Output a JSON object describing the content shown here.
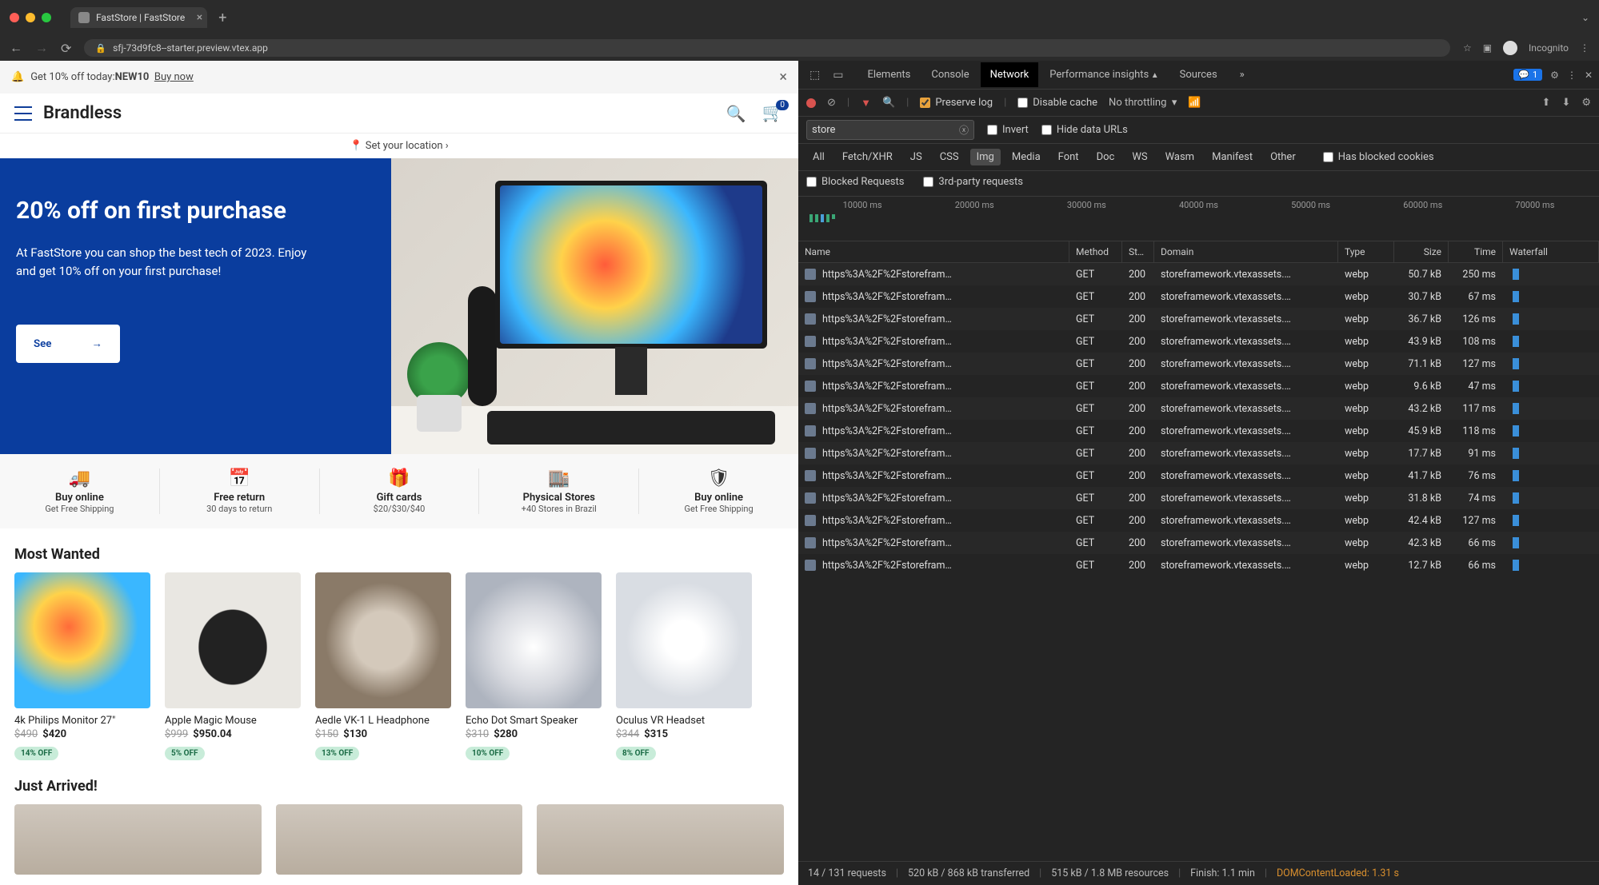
{
  "browser": {
    "tab_title": "FastStore | FastStore",
    "url": "sfj-73d9fc8--starter.preview.vtex.app",
    "incognito_label": "Incognito"
  },
  "site": {
    "promo": {
      "text_prefix": "Get 10% off today: ",
      "code": "NEW10",
      "link": "Buy now"
    },
    "brand": "Brandless",
    "cart_count": "0",
    "location_cta": "Set your location",
    "hero": {
      "title": "20% off on first purchase",
      "body": "At FastStore you can shop the best tech of 2023. Enjoy and get 10% off on your first purchase!",
      "btn": "See"
    },
    "features": [
      {
        "icon": "🚚",
        "title": "Buy online",
        "sub": "Get Free Shipping"
      },
      {
        "icon": "📅",
        "title": "Free return",
        "sub": "30 days to return"
      },
      {
        "icon": "🎁",
        "title": "Gift cards",
        "sub": "$20/$30/$40"
      },
      {
        "icon": "🏬",
        "title": "Physical Stores",
        "sub": "+40 Stores in Brazil"
      },
      {
        "icon": "🛡",
        "title": "Buy online",
        "sub": "Get Free Shipping"
      }
    ],
    "section_most": "Most Wanted",
    "products": [
      {
        "name": "4k Philips Monitor 27\"",
        "old": "$490",
        "new": "$420",
        "disc": "14% OFF"
      },
      {
        "name": "Apple Magic Mouse",
        "old": "$999",
        "new": "$950.04",
        "disc": "5% OFF"
      },
      {
        "name": "Aedle VK-1 L Headphone",
        "old": "$150",
        "new": "$130",
        "disc": "13% OFF"
      },
      {
        "name": "Echo Dot Smart Speaker",
        "old": "$310",
        "new": "$280",
        "disc": "10% OFF"
      },
      {
        "name": "Oculus VR Headset",
        "old": "$344",
        "new": "$315",
        "disc": "8% OFF"
      }
    ],
    "section_arrived": "Just Arrived!"
  },
  "devtools": {
    "tabs": [
      "Elements",
      "Console",
      "Network",
      "Performance insights",
      "Sources"
    ],
    "more": "»",
    "messages_count": "1",
    "toolbar": {
      "preserve": "Preserve log",
      "disable_cache": "Disable cache",
      "throttling": "No throttling"
    },
    "filter": {
      "value": "store",
      "invert": "Invert",
      "hide_urls": "Hide data URLs"
    },
    "types": [
      "All",
      "Fetch/XHR",
      "JS",
      "CSS",
      "Img",
      "Media",
      "Font",
      "Doc",
      "WS",
      "Wasm",
      "Manifest",
      "Other"
    ],
    "types_active": "Img",
    "blocked_cookies": "Has blocked cookies",
    "blocked_requests": "Blocked Requests",
    "third_party": "3rd-party requests",
    "timeline_labels": [
      "10000 ms",
      "20000 ms",
      "30000 ms",
      "40000 ms",
      "50000 ms",
      "60000 ms",
      "70000 ms"
    ],
    "columns": [
      "Name",
      "Method",
      "St…",
      "Domain",
      "Type",
      "Size",
      "Time",
      "Waterfall"
    ],
    "rows": [
      {
        "name": "https%3A%2F%2Fstorefram…",
        "method": "GET",
        "status": "200",
        "domain": "storeframework.vtexassets.…",
        "type": "webp",
        "size": "50.7 kB",
        "time": "250 ms"
      },
      {
        "name": "https%3A%2F%2Fstorefram…",
        "method": "GET",
        "status": "200",
        "domain": "storeframework.vtexassets.…",
        "type": "webp",
        "size": "30.7 kB",
        "time": "67 ms"
      },
      {
        "name": "https%3A%2F%2Fstorefram…",
        "method": "GET",
        "status": "200",
        "domain": "storeframework.vtexassets.…",
        "type": "webp",
        "size": "36.7 kB",
        "time": "126 ms"
      },
      {
        "name": "https%3A%2F%2Fstorefram…",
        "method": "GET",
        "status": "200",
        "domain": "storeframework.vtexassets.…",
        "type": "webp",
        "size": "43.9 kB",
        "time": "108 ms"
      },
      {
        "name": "https%3A%2F%2Fstorefram…",
        "method": "GET",
        "status": "200",
        "domain": "storeframework.vtexassets.…",
        "type": "webp",
        "size": "71.1 kB",
        "time": "127 ms"
      },
      {
        "name": "https%3A%2F%2Fstorefram…",
        "method": "GET",
        "status": "200",
        "domain": "storeframework.vtexassets.…",
        "type": "webp",
        "size": "9.6 kB",
        "time": "47 ms"
      },
      {
        "name": "https%3A%2F%2Fstorefram…",
        "method": "GET",
        "status": "200",
        "domain": "storeframework.vtexassets.…",
        "type": "webp",
        "size": "43.2 kB",
        "time": "117 ms"
      },
      {
        "name": "https%3A%2F%2Fstorefram…",
        "method": "GET",
        "status": "200",
        "domain": "storeframework.vtexassets.…",
        "type": "webp",
        "size": "45.9 kB",
        "time": "118 ms"
      },
      {
        "name": "https%3A%2F%2Fstorefram…",
        "method": "GET",
        "status": "200",
        "domain": "storeframework.vtexassets.…",
        "type": "webp",
        "size": "17.7 kB",
        "time": "91 ms"
      },
      {
        "name": "https%3A%2F%2Fstorefram…",
        "method": "GET",
        "status": "200",
        "domain": "storeframework.vtexassets.…",
        "type": "webp",
        "size": "41.7 kB",
        "time": "76 ms"
      },
      {
        "name": "https%3A%2F%2Fstorefram…",
        "method": "GET",
        "status": "200",
        "domain": "storeframework.vtexassets.…",
        "type": "webp",
        "size": "31.8 kB",
        "time": "74 ms"
      },
      {
        "name": "https%3A%2F%2Fstorefram…",
        "method": "GET",
        "status": "200",
        "domain": "storeframework.vtexassets.…",
        "type": "webp",
        "size": "42.4 kB",
        "time": "127 ms"
      },
      {
        "name": "https%3A%2F%2Fstorefram…",
        "method": "GET",
        "status": "200",
        "domain": "storeframework.vtexassets.…",
        "type": "webp",
        "size": "42.3 kB",
        "time": "66 ms"
      },
      {
        "name": "https%3A%2F%2Fstorefram…",
        "method": "GET",
        "status": "200",
        "domain": "storeframework.vtexassets.…",
        "type": "webp",
        "size": "12.7 kB",
        "time": "66 ms"
      }
    ],
    "status": {
      "requests": "14 / 131 requests",
      "transferred": "520 kB / 868 kB transferred",
      "resources": "515 kB / 1.8 MB resources",
      "finish": "Finish: 1.1 min",
      "dcl": "DOMContentLoaded: 1.31 s"
    }
  }
}
